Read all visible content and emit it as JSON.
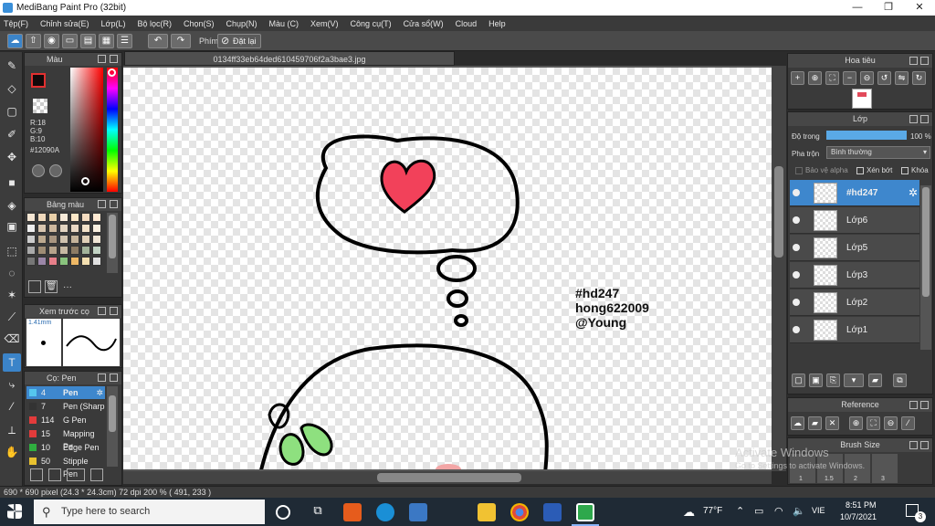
{
  "window": {
    "title": "MediBang Paint Pro (32bit)",
    "min": "—",
    "max": "❐",
    "close": "✕"
  },
  "menu": [
    "Tệp(F)",
    "Chỉnh sửa(E)",
    "Lớp(L)",
    "Bộ lọc(R)",
    "Chọn(S)",
    "Chụp(N)",
    "Màu (C)",
    "Xem(V)",
    "Công cụ(T)",
    "Cửa sổ(W)",
    "Cloud",
    "Help"
  ],
  "toolbar": {
    "brush_label": "Phím",
    "reset_label": "Đặt lại"
  },
  "document": {
    "tab_title": "0134ff33eb64ded610459706f2a3bae3.jpg"
  },
  "color_panel": {
    "title": "Màu",
    "r": "R:18",
    "g": "G:9",
    "b": "B:10",
    "hex": "#12090A",
    "fg_color": "#12090A",
    "bg_color": "#ffffff"
  },
  "palette_panel": {
    "title": "Bảng màu",
    "more": "···"
  },
  "brush_preview": {
    "title": "Xem trước cọ",
    "size": "1.41mm"
  },
  "brush_list": {
    "title": "Cọ: Pen",
    "items": [
      {
        "size": "4",
        "name": "Pen",
        "color": "#55c6ee",
        "selected": true
      },
      {
        "size": "7",
        "name": "Pen (Sharp",
        "color": "#333333",
        "selected": false
      },
      {
        "size": "114",
        "name": "G Pen",
        "color": "#e23b3b",
        "selected": false
      },
      {
        "size": "15",
        "name": "Mapping Pe",
        "color": "#e23b3b",
        "selected": false
      },
      {
        "size": "10",
        "name": "Edge Pen",
        "color": "#2fae3f",
        "selected": false
      },
      {
        "size": "50",
        "name": "Stipple Pen",
        "color": "#e8c12f",
        "selected": false
      }
    ]
  },
  "canvas_text": {
    "line1": "#hd247",
    "line2": "hong622009",
    "line3": "@Young"
  },
  "navigator": {
    "title": "Hoa tiêu"
  },
  "layers_panel": {
    "title": "Lớp",
    "opacity_label": "Độ trong",
    "opacity_value": "100 %",
    "blend_label": "Pha trộn",
    "blend_value": "Bình thường",
    "protect_alpha": "Bảo vệ alpha",
    "clipping": "Xén bớt",
    "lock": "Khóa",
    "layers": [
      {
        "name": "#hd247",
        "selected": true
      },
      {
        "name": "Lớp6",
        "selected": false
      },
      {
        "name": "Lớp5",
        "selected": false
      },
      {
        "name": "Lớp3",
        "selected": false
      },
      {
        "name": "Lớp2",
        "selected": false
      },
      {
        "name": "Lớp1",
        "selected": false
      }
    ]
  },
  "reference_panel": {
    "title": "Reference"
  },
  "brush_size_panel": {
    "title": "Brush Size",
    "sizes": [
      "1",
      "1.5",
      "2",
      "3"
    ]
  },
  "status_bar": {
    "text": "690 * 690 pixel   (24.3 * 24.3cm)   72 dpi   200 %   ( 491, 233 )"
  },
  "watermark": {
    "line1": "Activate Windows",
    "line2": "Go to Settings to activate Windows."
  },
  "taskbar": {
    "search_placeholder": "Type here to search",
    "weather": "77°F",
    "lang": "VIE",
    "time": "8:51 PM",
    "date": "10/7/2021",
    "notifications": "3"
  }
}
